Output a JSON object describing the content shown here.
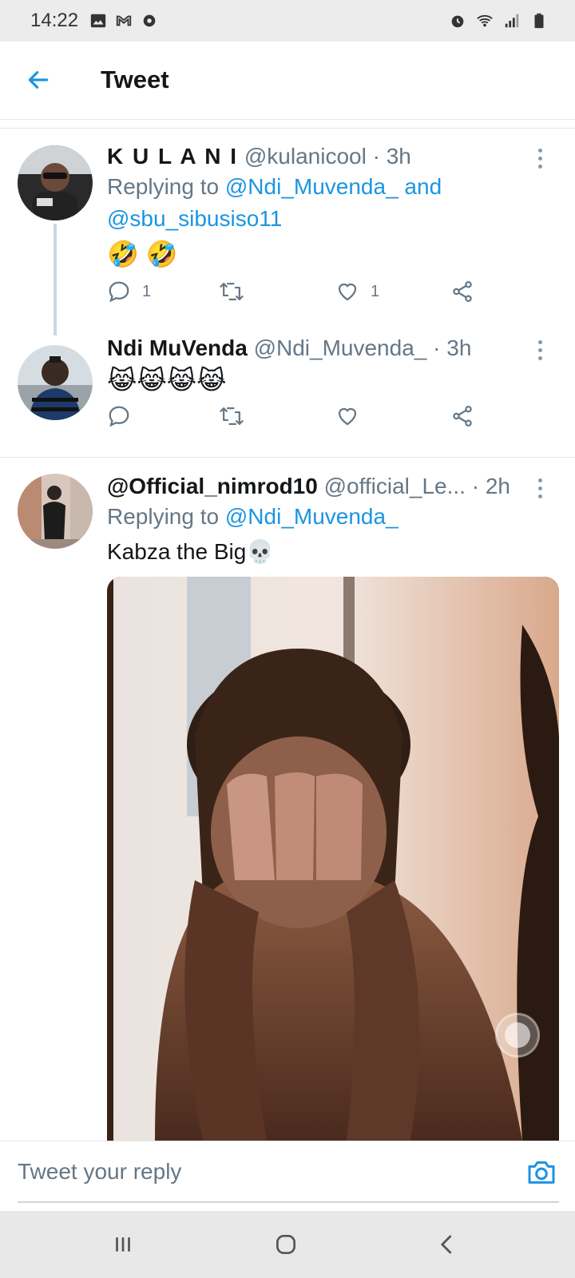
{
  "status_bar": {
    "time": "14:22",
    "left_icons": [
      "image-icon",
      "gmail-icon",
      "settings-icon"
    ],
    "right_icons": [
      "alarm-icon",
      "wifi-icon",
      "signal-icon",
      "battery-icon"
    ]
  },
  "header": {
    "back_icon": "back-arrow-icon",
    "title": "Tweet"
  },
  "tweets": [
    {
      "name": "K U L A N I",
      "handle": "@kulanicool",
      "time": " · 3h",
      "reply_prefix": "Replying to ",
      "reply_to_1": "@Ndi_Muvenda_",
      "reply_and": " and",
      "reply_to_2": "@sbu_sibusiso11",
      "text": "🤣 🤣",
      "replies": "1",
      "retweets": "",
      "likes": "1"
    },
    {
      "name": "Ndi MuVenda",
      "handle": "@Ndi_Muvenda_",
      "time": " · 3h",
      "text": "😹😹😹😹",
      "replies": "",
      "retweets": "",
      "likes": ""
    },
    {
      "name": "@Official_nimrod10",
      "handle": "@official_Le...",
      "time": " · 2h",
      "reply_prefix": "Replying to ",
      "reply_to_1": "@Ndi_Muvenda_",
      "text": "Kabza the Big💀",
      "media": "video"
    }
  ],
  "reply_bar": {
    "placeholder": "Tweet your reply",
    "camera_icon": "camera-icon"
  },
  "nav_bar": {
    "buttons": [
      "recent-apps-icon",
      "home-icon",
      "back-icon"
    ]
  },
  "colors": {
    "accent": "#1b95e0",
    "muted": "#657786",
    "border": "#e1e8ed"
  }
}
